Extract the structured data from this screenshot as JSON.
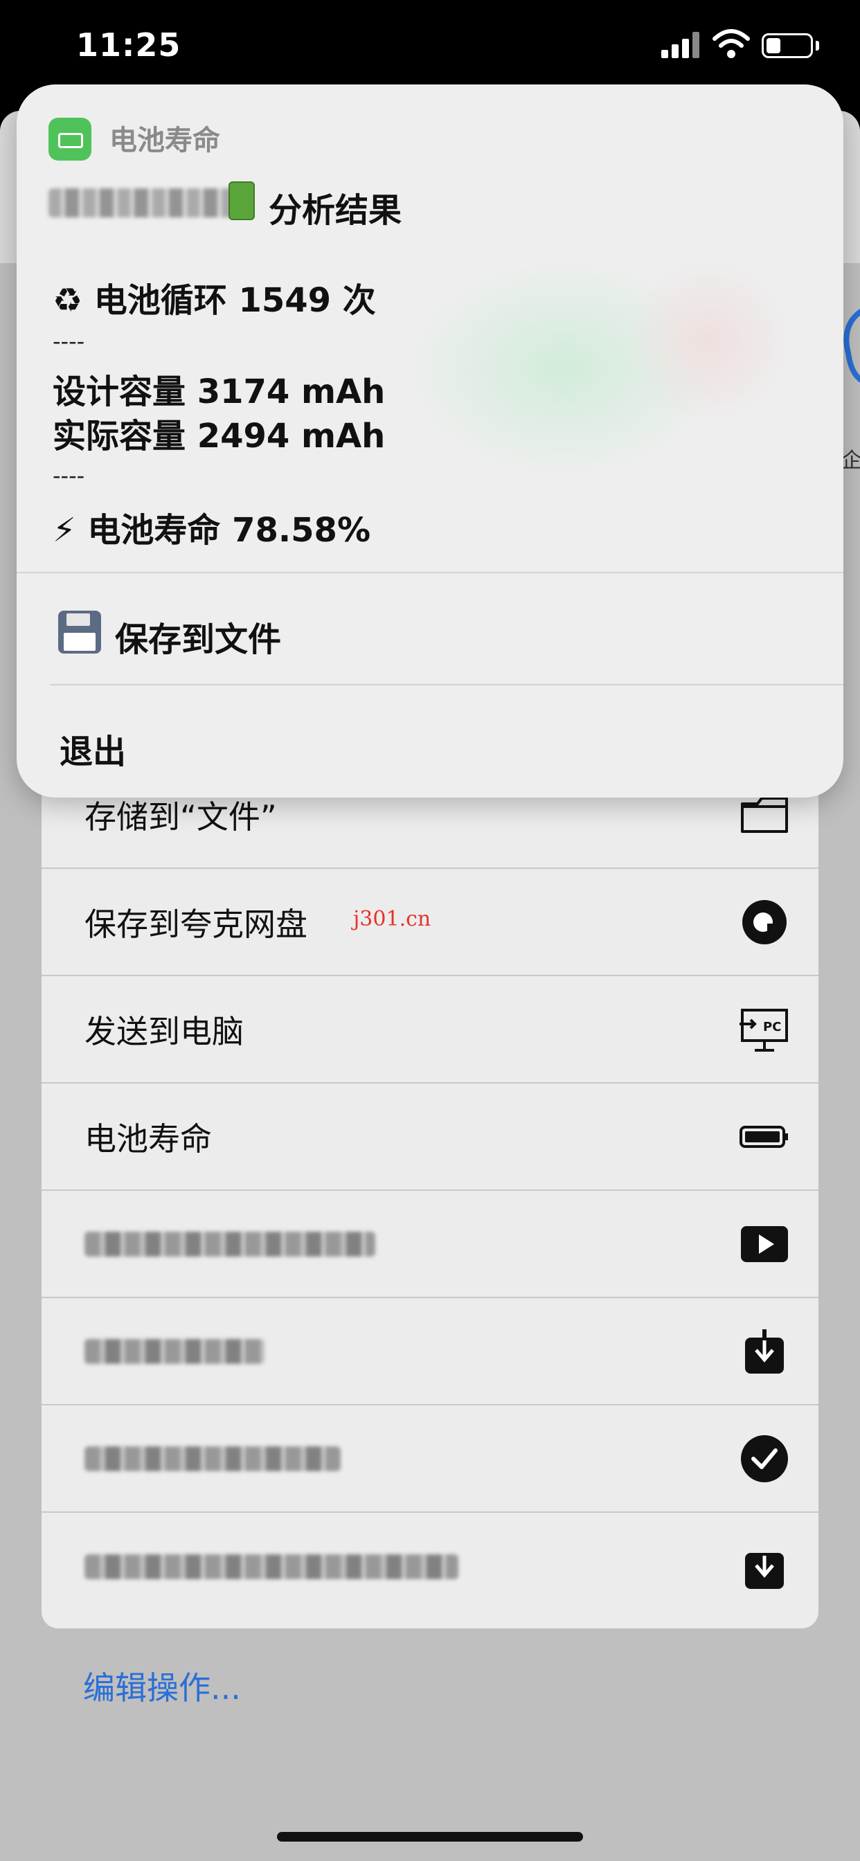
{
  "status_bar": {
    "time": "11:25"
  },
  "card": {
    "app_name": "电池寿命",
    "result_title": "分析结果",
    "cycles_line": "♻ 电池循环 1549 次",
    "separator": "----",
    "design_capacity_line": "设计容量 3174 mAh",
    "actual_capacity_line": "实际容量 2494 mAh",
    "health_line": "⚡ 电池寿命 78.58%",
    "save_to_file": "保存到文件",
    "exit": "退出"
  },
  "actions": [
    {
      "label": "存储到“文件”",
      "icon": "folder-icon"
    },
    {
      "label": "保存到夸克网盘",
      "icon": "quark-icon"
    },
    {
      "label": "发送到电脑",
      "icon": "pc-icon"
    },
    {
      "label": "电池寿命",
      "icon": "battery-icon"
    },
    {
      "label": "",
      "icon": "play-icon"
    },
    {
      "label": "",
      "icon": "download-icon"
    },
    {
      "label": "",
      "icon": "checkmark-icon"
    },
    {
      "label": "",
      "icon": "download-icon"
    }
  ],
  "watermark": "j301.cn",
  "edit_actions": "编辑操作...",
  "edge_char": "企"
}
